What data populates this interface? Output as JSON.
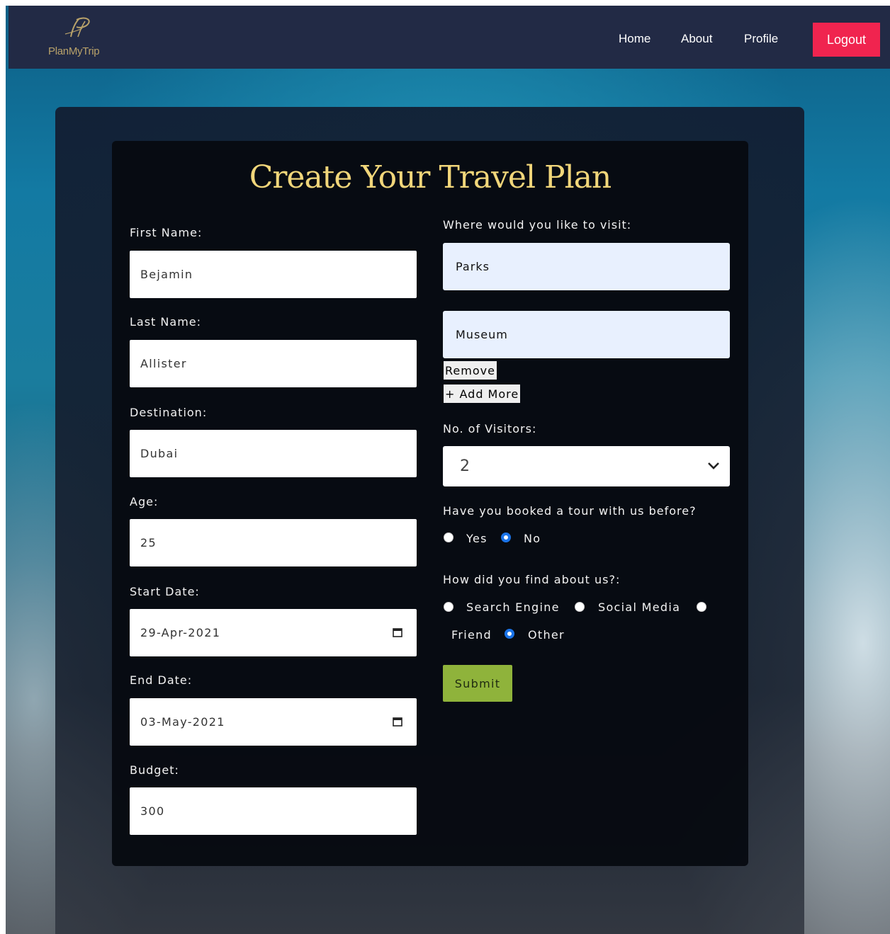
{
  "navbar": {
    "brand": "PlanMyTrip",
    "links": [
      "Home",
      "About",
      "Profile"
    ],
    "logout_label": "Logout"
  },
  "form": {
    "title": "Create Your Travel Plan",
    "first_name": {
      "label": "First Name:",
      "value": "Bejamin"
    },
    "last_name": {
      "label": "Last Name:",
      "value": "Allister"
    },
    "destination": {
      "label": "Destination:",
      "value": "Dubai"
    },
    "age": {
      "label": "Age:",
      "value": "25"
    },
    "start_date": {
      "label": "Start Date:",
      "value": "29-Apr-2021"
    },
    "end_date": {
      "label": "End Date:",
      "value": "03-May-2021"
    },
    "budget": {
      "label": "Budget:",
      "value": "300"
    },
    "visit": {
      "label": "Where would you like to visit:",
      "places": [
        "Parks",
        "Museum"
      ],
      "remove_label": "Remove",
      "add_more_label": "+ Add More"
    },
    "visitors": {
      "label": "No. of Visitors:",
      "selected": "2"
    },
    "booked_before": {
      "question": "Have you booked a tour with us before?",
      "options": [
        "Yes",
        "No"
      ],
      "selected": "No"
    },
    "find_us": {
      "question": "How did you find about us?:",
      "options": [
        "Search Engine",
        "Social Media",
        "Friend",
        "Other"
      ],
      "selected": "Other"
    },
    "submit_label": "Submit"
  },
  "colors": {
    "navbar_bg": "#222a45",
    "logout_bg": "#f0244f",
    "title_gold": "#f1d67a",
    "submit_bg": "#8fb33b",
    "radio_selected": "#1a73e8"
  }
}
